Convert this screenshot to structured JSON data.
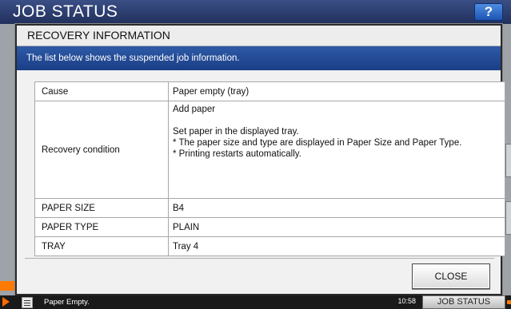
{
  "screen": {
    "title": "JOB STATUS",
    "help_label": "?"
  },
  "dialog": {
    "title": "RECOVERY INFORMATION",
    "banner": "The list below shows the suspended job information.",
    "rows": {
      "cause": {
        "label": "Cause",
        "value": "Paper empty (tray)"
      },
      "recovery": {
        "label": "Recovery condition",
        "lines": [
          "Add paper",
          "Set paper in the displayed tray.",
          "* The paper size and type are displayed in Paper Size and Paper Type.",
          "* Printing restarts automatically."
        ]
      },
      "paper_size": {
        "label": "PAPER SIZE",
        "value": "B4"
      },
      "paper_type": {
        "label": "PAPER TYPE",
        "value": "PLAIN"
      },
      "tray": {
        "label": "TRAY",
        "value": "Tray 4"
      }
    },
    "close_label": "CLOSE"
  },
  "status_bar": {
    "message": "Paper Empty.",
    "time": "10:58",
    "job_status_label": "JOB STATUS"
  },
  "colors": {
    "banner": "#1f4a94",
    "header": "#2a3b6e",
    "accent": "#ff7a00"
  }
}
